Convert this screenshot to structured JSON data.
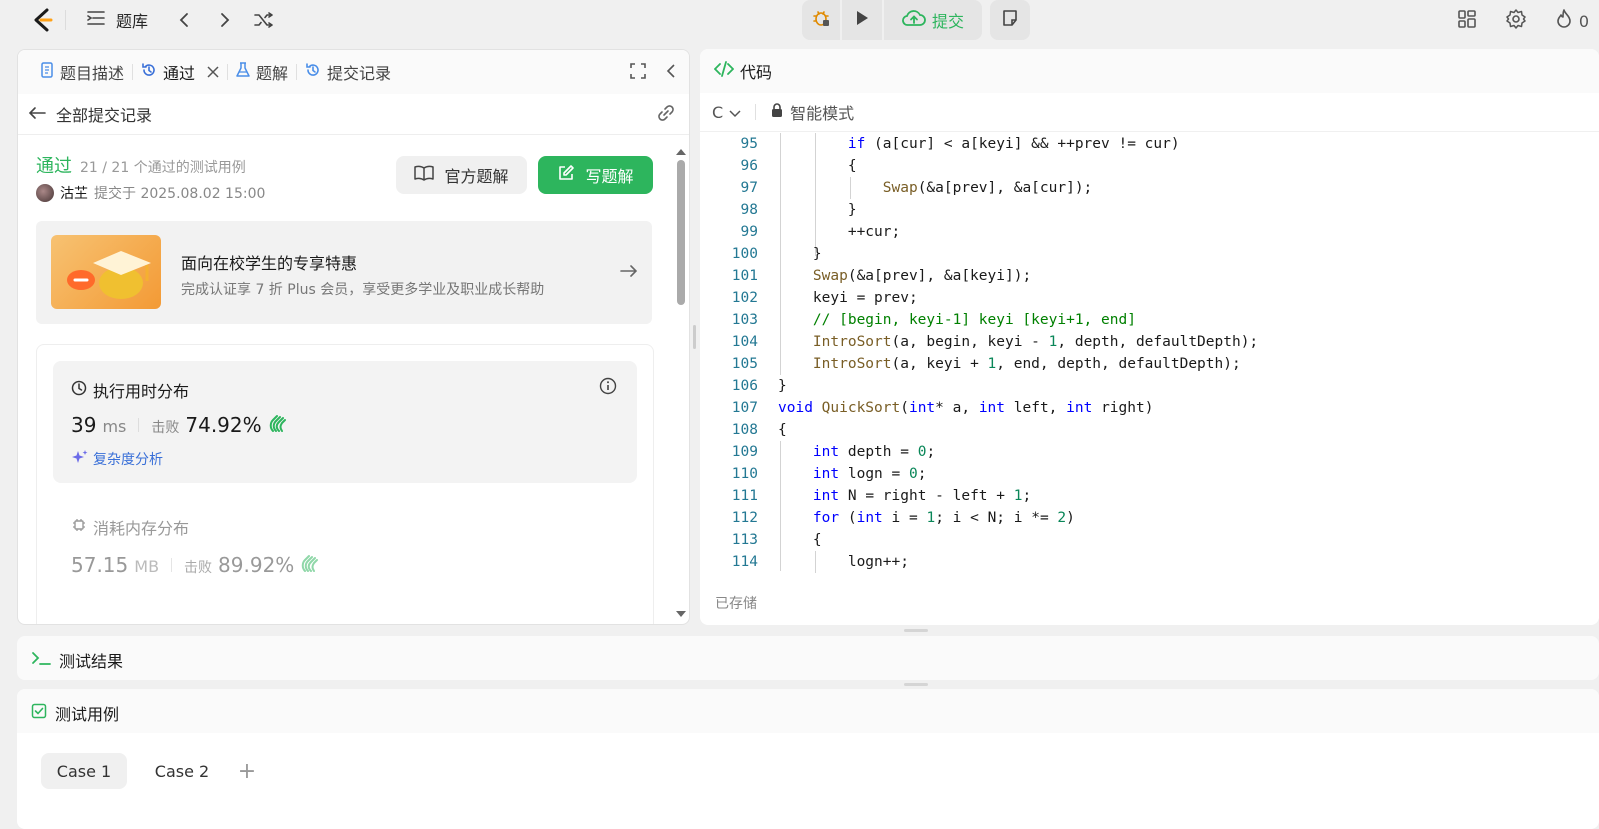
{
  "topbar": {
    "title": "题库",
    "submit_label": "提交",
    "streak_count": "0",
    "brand_color": "#ffa116",
    "submit_color": "#2db55d"
  },
  "left_tabs": [
    {
      "label": "题目描述"
    },
    {
      "label": "通过"
    },
    {
      "label": "题解"
    },
    {
      "label": "提交记录"
    }
  ],
  "subheader": {
    "back_label": "全部提交记录"
  },
  "result": {
    "status": "通过",
    "cases": "21 / 21  个通过的测试用例",
    "user": "沽芏",
    "submitted": "提交于 2025.08.02 15:00",
    "official_label": "官方题解",
    "write_label": "写题解"
  },
  "promo": {
    "title": "面向在校学生的专享特惠",
    "subtitle": "完成认证享 7 折 Plus 会员，享受更多学业及职业成长帮助"
  },
  "runtime": {
    "title": "执行用时分布",
    "value": "39",
    "unit": "ms",
    "beat_label": "击败",
    "beat": "74.92%",
    "complexity": "复杂度分析"
  },
  "memory": {
    "title": "消耗内存分布",
    "value": "57.15",
    "unit": "MB",
    "beat_label": "击败",
    "beat": "89.92%"
  },
  "code_panel": {
    "title": "代码",
    "language": "C",
    "mode": "智能模式",
    "saved": "已存储"
  },
  "code_lines": [
    {
      "n": "95"
    },
    {
      "n": "96"
    },
    {
      "n": "97"
    },
    {
      "n": "98"
    },
    {
      "n": "99"
    },
    {
      "n": "100"
    },
    {
      "n": "101"
    },
    {
      "n": "102"
    },
    {
      "n": "103"
    },
    {
      "n": "104"
    },
    {
      "n": "105"
    },
    {
      "n": "106"
    },
    {
      "n": "107"
    },
    {
      "n": "108"
    },
    {
      "n": "109"
    },
    {
      "n": "110"
    },
    {
      "n": "111"
    },
    {
      "n": "112"
    },
    {
      "n": "113"
    },
    {
      "n": "114"
    }
  ],
  "bottom": {
    "test_result": "测试结果",
    "test_case": "测试用例",
    "cases": [
      "Case 1",
      "Case 2"
    ],
    "add": "+"
  }
}
